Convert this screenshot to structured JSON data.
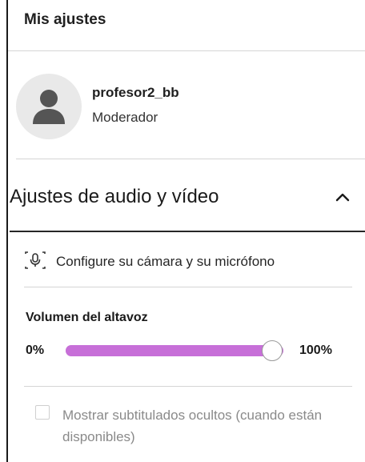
{
  "header": {
    "title": "Mis ajustes"
  },
  "profile": {
    "username": "profesor2_bb",
    "role": "Moderador",
    "avatar_icon": "user-silhouette-icon"
  },
  "audio_video": {
    "title": "Ajustes de audio y vídeo",
    "expanded": true,
    "configure_label": "Configure su cámara y su micrófono",
    "volume": {
      "label": "Volumen del altavoz",
      "min_label": "0%",
      "max_label": "100%",
      "value_percent": 100,
      "fill_color": "#c76fd8"
    },
    "captions": {
      "label": "Mostrar subtitulados ocultos (cuando están disponibles)",
      "checked": false,
      "disabled": true
    }
  }
}
